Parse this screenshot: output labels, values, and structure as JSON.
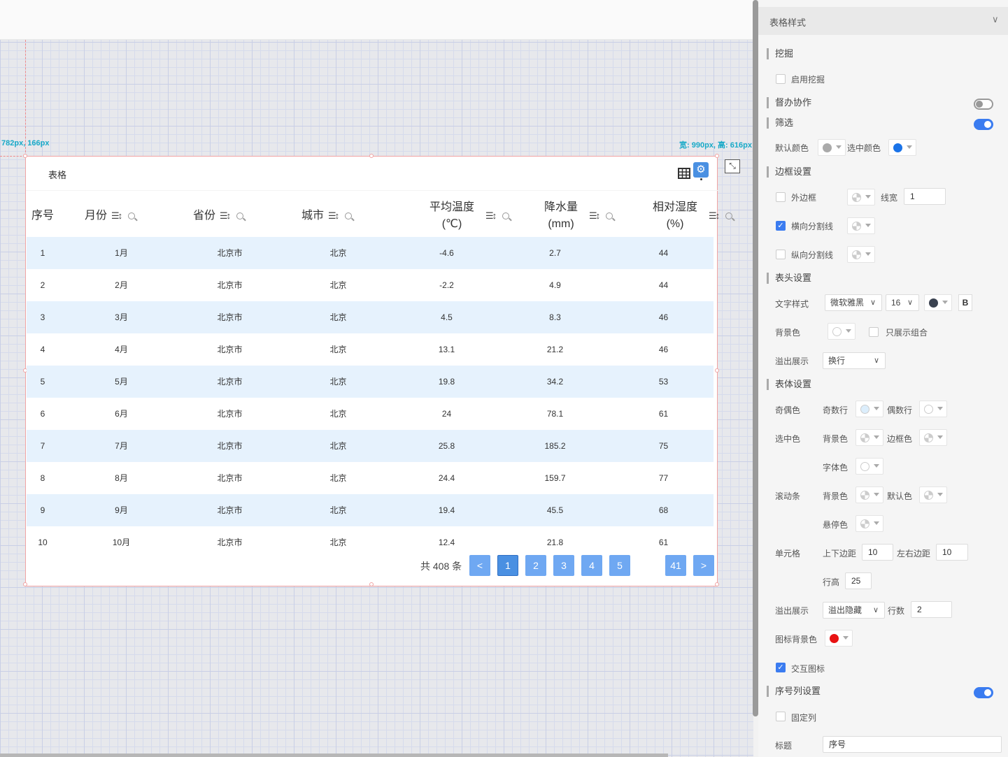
{
  "canvas": {
    "pos_readout": "782px, 166px",
    "size_readout": "宽: 990px, 高: 616px"
  },
  "widget": {
    "title": "表格",
    "columns": [
      "序号",
      "月份",
      "省份",
      "城市",
      "平均温度\n(℃)",
      "降水量\n(mm)",
      "相对湿度\n(%)"
    ],
    "rows": [
      [
        "1",
        "1月",
        "北京市",
        "北京",
        "-4.6",
        "2.7",
        "44"
      ],
      [
        "2",
        "2月",
        "北京市",
        "北京",
        "-2.2",
        "4.9",
        "44"
      ],
      [
        "3",
        "3月",
        "北京市",
        "北京",
        "4.5",
        "8.3",
        "46"
      ],
      [
        "4",
        "4月",
        "北京市",
        "北京",
        "13.1",
        "21.2",
        "46"
      ],
      [
        "5",
        "5月",
        "北京市",
        "北京",
        "19.8",
        "34.2",
        "53"
      ],
      [
        "6",
        "6月",
        "北京市",
        "北京",
        "24",
        "78.1",
        "61"
      ],
      [
        "7",
        "7月",
        "北京市",
        "北京",
        "25.8",
        "185.2",
        "75"
      ],
      [
        "8",
        "8月",
        "北京市",
        "北京",
        "24.4",
        "159.7",
        "77"
      ],
      [
        "9",
        "9月",
        "北京市",
        "北京",
        "19.4",
        "45.5",
        "68"
      ],
      [
        "10",
        "10月",
        "北京市",
        "北京",
        "12.4",
        "21.8",
        "61"
      ]
    ],
    "pagination": {
      "total": "共 408 条",
      "prev": "<",
      "pages": [
        "1",
        "2",
        "3",
        "4",
        "5"
      ],
      "last": "41",
      "next": ">",
      "current": "1"
    }
  },
  "panel": {
    "header": "表格样式",
    "mining": {
      "title": "挖掘",
      "enable": "启用挖掘"
    },
    "supervise": "督办协作",
    "filter": {
      "title": "筛选",
      "default_color": "默认颜色",
      "selected_color": "选中颜色"
    },
    "border": {
      "title": "边框设置",
      "outer": "外边框",
      "line_width_label": "线宽",
      "line_width": "1",
      "h_divider": "横向分割线",
      "v_divider": "纵向分割线"
    },
    "header_settings": {
      "title": "表头设置",
      "text_style": "文字样式",
      "font": "微软雅黑",
      "size": "16",
      "bold": "B",
      "bg_color": "背景色",
      "only_group": "只展示组合",
      "overflow": "溢出展示",
      "overflow_value": "换行"
    },
    "body": {
      "title": "表体设置",
      "odd_even": "奇偶色",
      "odd_row": "奇数行",
      "even_row": "偶数行",
      "selected": "选中色",
      "sel_bg": "背景色",
      "sel_border": "边框色",
      "sel_font": "字体色",
      "scrollbar": "滚动条",
      "sb_bg": "背景色",
      "sb_default": "默认色",
      "sb_hover": "悬停色",
      "cell": "单元格",
      "pad_v_label": "上下边距",
      "pad_v": "10",
      "pad_h_label": "左右边距",
      "pad_h": "10",
      "row_height_label": "行高",
      "row_height": "25",
      "overflow": "溢出展示",
      "overflow_value": "溢出隐藏",
      "lines_label": "行数",
      "lines": "2",
      "icon_bg": "图标背景色",
      "interactive_icon": "交互图标"
    },
    "index_col": {
      "title": "序号列设置",
      "fixed": "固定列",
      "title_label": "标题",
      "title_value": "序号"
    }
  },
  "colors": {
    "accent": "#3b7cf0",
    "row_odd": "#e6f2fd",
    "filter_selected": "#1a73e8",
    "filter_default": "#aaaaaa",
    "header_text": "#3a4250",
    "icon_bg": "#e81212",
    "odd_row_swatch": "#dceefc"
  }
}
